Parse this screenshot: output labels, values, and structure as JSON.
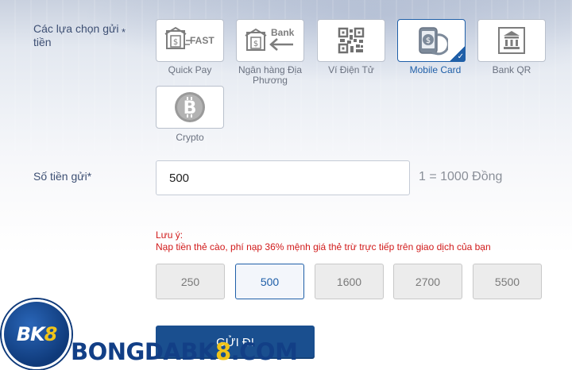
{
  "deposit": {
    "method_label": "Các lựa chọn gửi tiền",
    "required_mark": "*",
    "methods": [
      {
        "name": "Quick Pay",
        "icon": "quick-pay-icon",
        "icon_text": "FAST",
        "selected": false
      },
      {
        "name": "Ngân hàng Địa Phương",
        "icon": "local-bank-icon",
        "icon_text": "Bank",
        "selected": false
      },
      {
        "name": "Ví Điện Tử",
        "icon": "qr-code-icon",
        "selected": false
      },
      {
        "name": "Mobile Card",
        "icon": "mobile-card-icon",
        "selected": true
      },
      {
        "name": "Bank QR",
        "icon": "bank-qr-icon",
        "selected": false
      },
      {
        "name": "Crypto",
        "icon": "bitcoin-icon",
        "selected": false
      }
    ],
    "amount_label": "Số tiền gửi*",
    "amount_value": "500",
    "rate": "1 = 1000 Đồng",
    "note_title": "Lưu ý:",
    "note_text": "Nạp tiền thẻ cào, phí nạp 36% mệnh giá thẻ trừ trực tiếp trên giao dịch của bạn",
    "presets": [
      "250",
      "500",
      "1600",
      "2700",
      "5500"
    ],
    "active_preset": "500",
    "submit_label": "GỬI ĐI"
  },
  "branding": {
    "logo_prefix": "BK",
    "logo_suffix": "8",
    "watermark_prefix": "BONGDABK",
    "watermark_eight": "8",
    "watermark_suffix": ".COM"
  },
  "colors": {
    "accent": "#1f5fa8",
    "submit_bg": "#1a4f8f",
    "note": "#d11a1a",
    "brand_yellow": "#f0c419"
  }
}
